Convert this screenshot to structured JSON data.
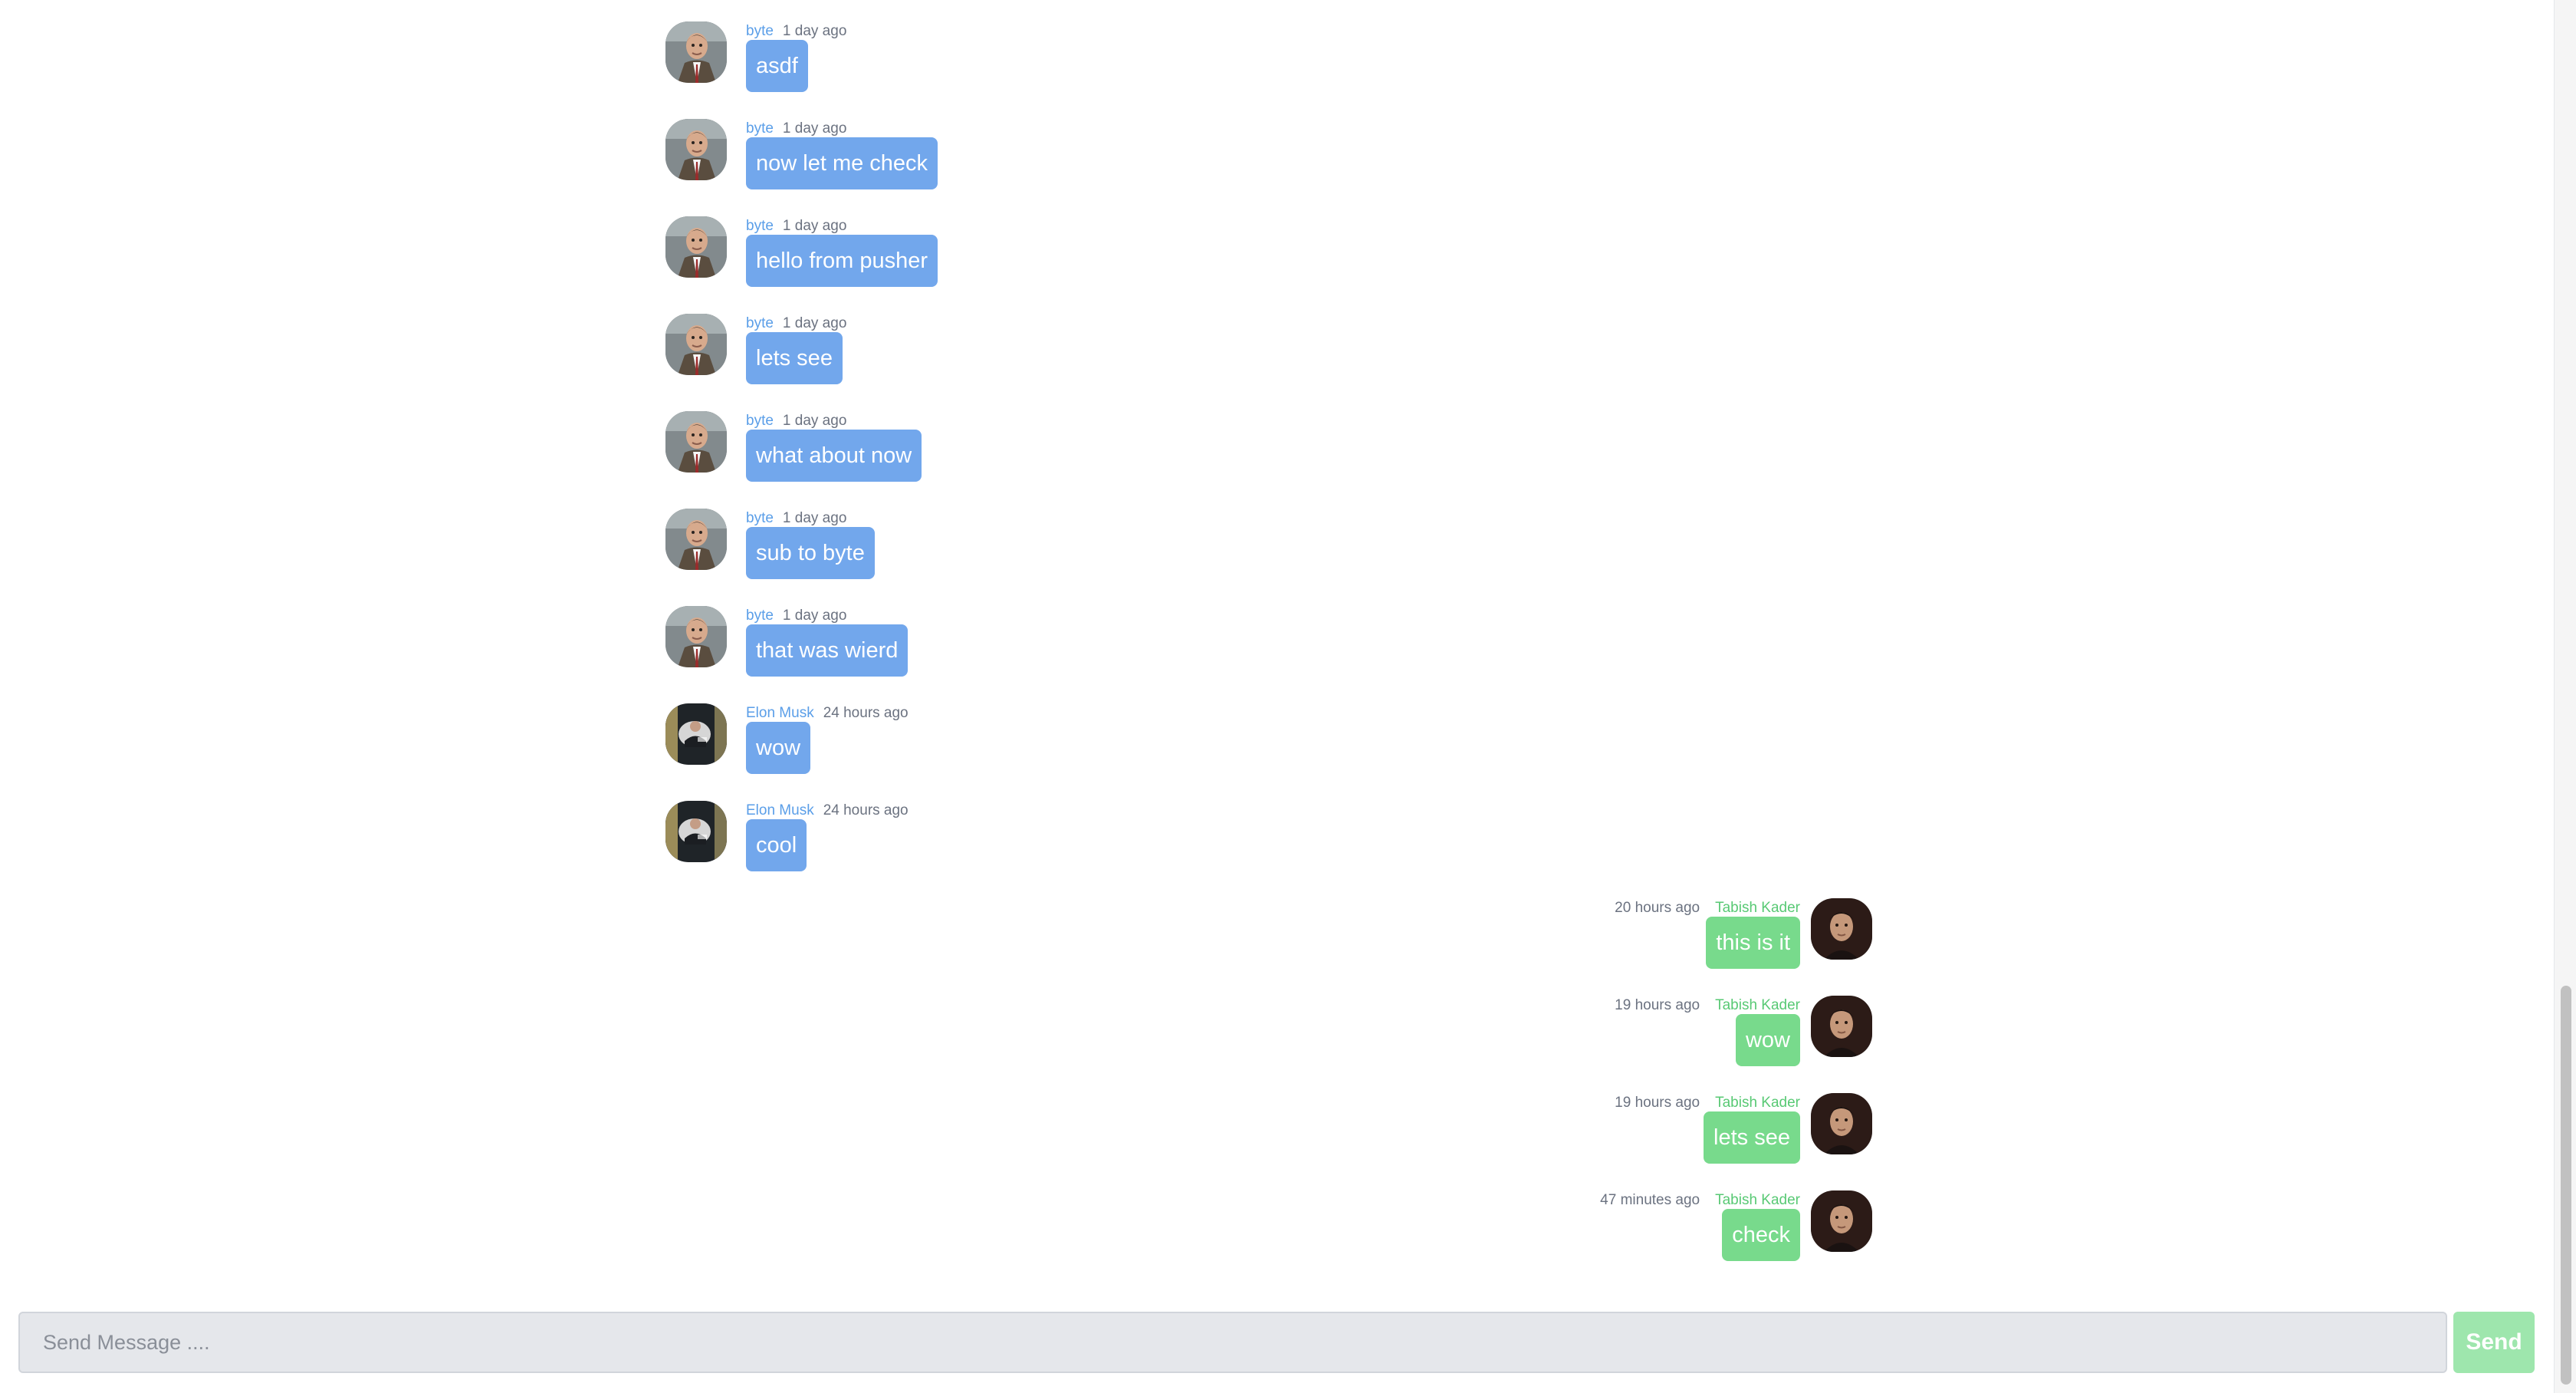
{
  "composer": {
    "placeholder": "Send Message ....",
    "send_label": "Send"
  },
  "messages": [
    {
      "direction": "incoming",
      "sender": "byte",
      "time": "1 day ago",
      "text": "asdf",
      "avatar": "mr-bean-avatar"
    },
    {
      "direction": "incoming",
      "sender": "byte",
      "time": "1 day ago",
      "text": "now let me check",
      "avatar": "mr-bean-avatar"
    },
    {
      "direction": "incoming",
      "sender": "byte",
      "time": "1 day ago",
      "text": "hello from pusher",
      "avatar": "mr-bean-avatar"
    },
    {
      "direction": "incoming",
      "sender": "byte",
      "time": "1 day ago",
      "text": "lets see",
      "avatar": "mr-bean-avatar"
    },
    {
      "direction": "incoming",
      "sender": "byte",
      "time": "1 day ago",
      "text": "what about now",
      "avatar": "mr-bean-avatar"
    },
    {
      "direction": "incoming",
      "sender": "byte",
      "time": "1 day ago",
      "text": "sub to byte",
      "avatar": "mr-bean-avatar"
    },
    {
      "direction": "incoming",
      "sender": "byte",
      "time": "1 day ago",
      "text": "that was wierd",
      "avatar": "mr-bean-avatar"
    },
    {
      "direction": "incoming",
      "sender": "Elon Musk",
      "time": "24 hours ago",
      "text": "wow",
      "avatar": "elon-musk-avatar"
    },
    {
      "direction": "incoming",
      "sender": "Elon Musk",
      "time": "24 hours ago",
      "text": "cool",
      "avatar": "elon-musk-avatar"
    },
    {
      "direction": "outgoing",
      "sender": "Tabish Kader",
      "time": "20 hours ago",
      "text": "this is it",
      "avatar": "tabish-kader-avatar"
    },
    {
      "direction": "outgoing",
      "sender": "Tabish Kader",
      "time": "19 hours ago",
      "text": "wow",
      "avatar": "tabish-kader-avatar"
    },
    {
      "direction": "outgoing",
      "sender": "Tabish Kader",
      "time": "19 hours ago",
      "text": "lets see",
      "avatar": "tabish-kader-avatar"
    },
    {
      "direction": "outgoing",
      "sender": "Tabish Kader",
      "time": "47 minutes ago",
      "text": "check",
      "avatar": "tabish-kader-avatar"
    }
  ],
  "theme": {
    "incoming_bubble": "#72a7ec",
    "outgoing_bubble": "#78da8c",
    "incoming_name": "#5a9ee8",
    "outgoing_name": "#58c974",
    "send_button": "#9ee6ad"
  }
}
